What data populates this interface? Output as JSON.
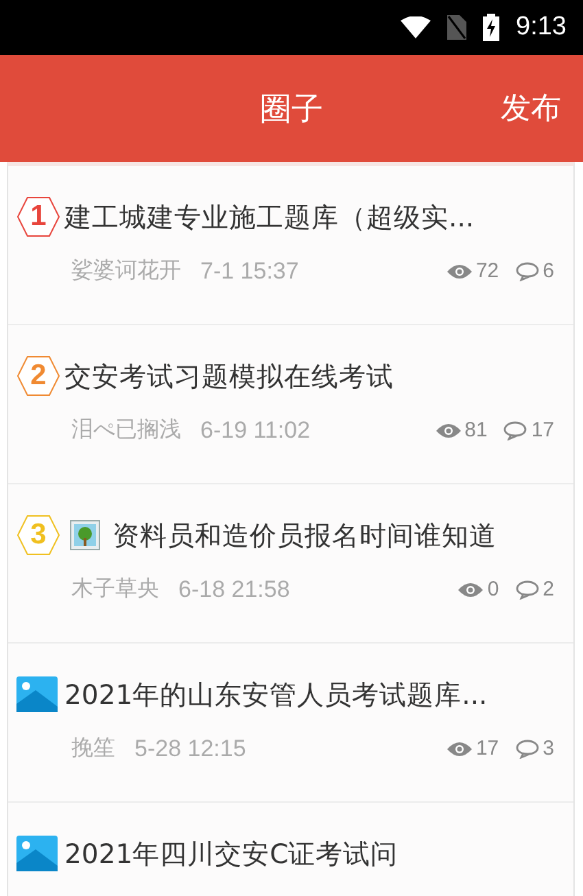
{
  "status_bar": {
    "time": "9:13"
  },
  "header": {
    "title": "圈子",
    "action": "发布"
  },
  "posts": [
    {
      "marker": {
        "kind": "rank",
        "text": "1",
        "color": "#e8453c"
      },
      "thumbnail": false,
      "title": "建工城建专业施工题库（超级实...",
      "author": "娑婆诃花开",
      "time": "7-1 15:37",
      "views": "72",
      "comments": "6"
    },
    {
      "marker": {
        "kind": "rank",
        "text": "2",
        "color": "#f08a32"
      },
      "thumbnail": false,
      "title": "交安考试习题模拟在线考试",
      "author": "泪ぺ已搁浅",
      "time": "6-19 11:02",
      "views": "81",
      "comments": "17"
    },
    {
      "marker": {
        "kind": "rank",
        "text": "3",
        "color": "#f0c020"
      },
      "thumbnail": true,
      "title": "资料员和造价员报名时间谁知道",
      "author": "木子草央",
      "time": "6-18 21:58",
      "views": "0",
      "comments": "2"
    },
    {
      "thumbnail": false,
      "title": "2021年的山东安管人员考试题库...",
      "author": "挽笙",
      "time": "5-28 12:15",
      "views": "17",
      "comments": "3"
    },
    {
      "thumbnail": false,
      "title": "2021年四川交安C证考试问"
    }
  ]
}
